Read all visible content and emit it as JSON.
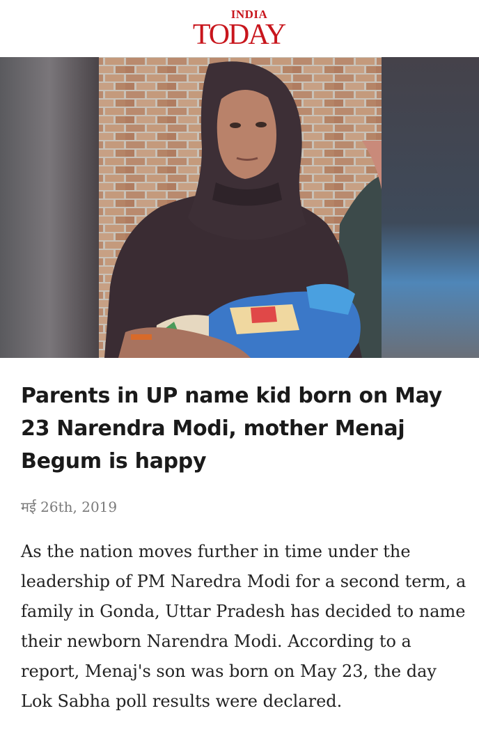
{
  "brand": {
    "top": "INDIA",
    "main": "TODAY",
    "color": "#c8161d"
  },
  "article": {
    "headline": "Parents in UP name kid born on May 23 Narendra Modi, mother Menaj Begum is happy",
    "date": "मई 26th, 2019",
    "body": "As the nation moves further in time under the leadership of PM Naredra Modi for a second term, a family in Gonda, Uttar Pradesh has decided to name their newborn Narendra Modi. According to a report, Menaj's son was born on May 23, the day Lok Sabha poll results were declared."
  }
}
